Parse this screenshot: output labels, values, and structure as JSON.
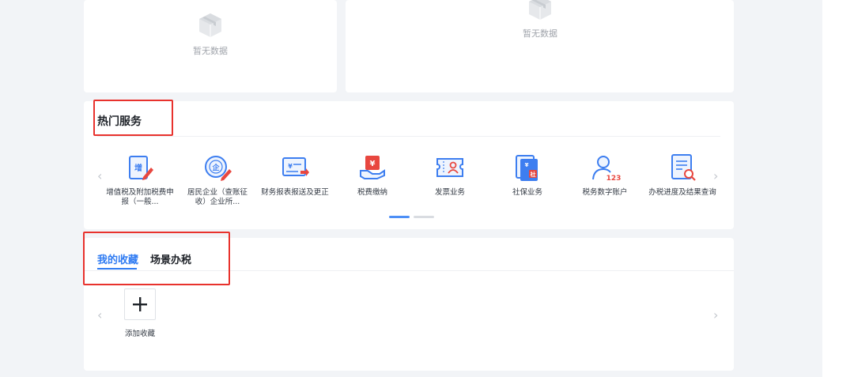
{
  "empty_cards": {
    "left_text": "暂无数据",
    "right_text": "暂无数据"
  },
  "hot_services": {
    "title": "热门服务",
    "prev_arrow": "‹",
    "next_arrow": "›",
    "items": [
      {
        "label": "增值税及附加税费申报（一般...",
        "icon": "tax-report-icon"
      },
      {
        "label": "居民企业（查账征收）企业所...",
        "icon": "enterprise-income-icon"
      },
      {
        "label": "财务报表报送及更正",
        "icon": "financial-statement-icon"
      },
      {
        "label": "税费缴纳",
        "icon": "tax-payment-icon"
      },
      {
        "label": "发票业务",
        "icon": "invoice-icon"
      },
      {
        "label": "社保业务",
        "icon": "social-security-icon"
      },
      {
        "label": "税务数字账户",
        "icon": "digital-account-icon"
      },
      {
        "label": "办税进度及结果查询",
        "icon": "progress-query-icon"
      }
    ],
    "pager": {
      "pages": 2,
      "current": 1
    }
  },
  "favorites": {
    "tabs": [
      {
        "label": "我的收藏",
        "active": true
      },
      {
        "label": "场景办税",
        "active": false
      }
    ],
    "prev_arrow": "‹",
    "next_arrow": "›",
    "add_label": "添加收藏"
  },
  "colors": {
    "accent": "#2f7bf2",
    "highlight": "#e8322d",
    "icon_blue": "#3d7ef0",
    "icon_red": "#e8473f",
    "background": "#f2f4f7"
  }
}
